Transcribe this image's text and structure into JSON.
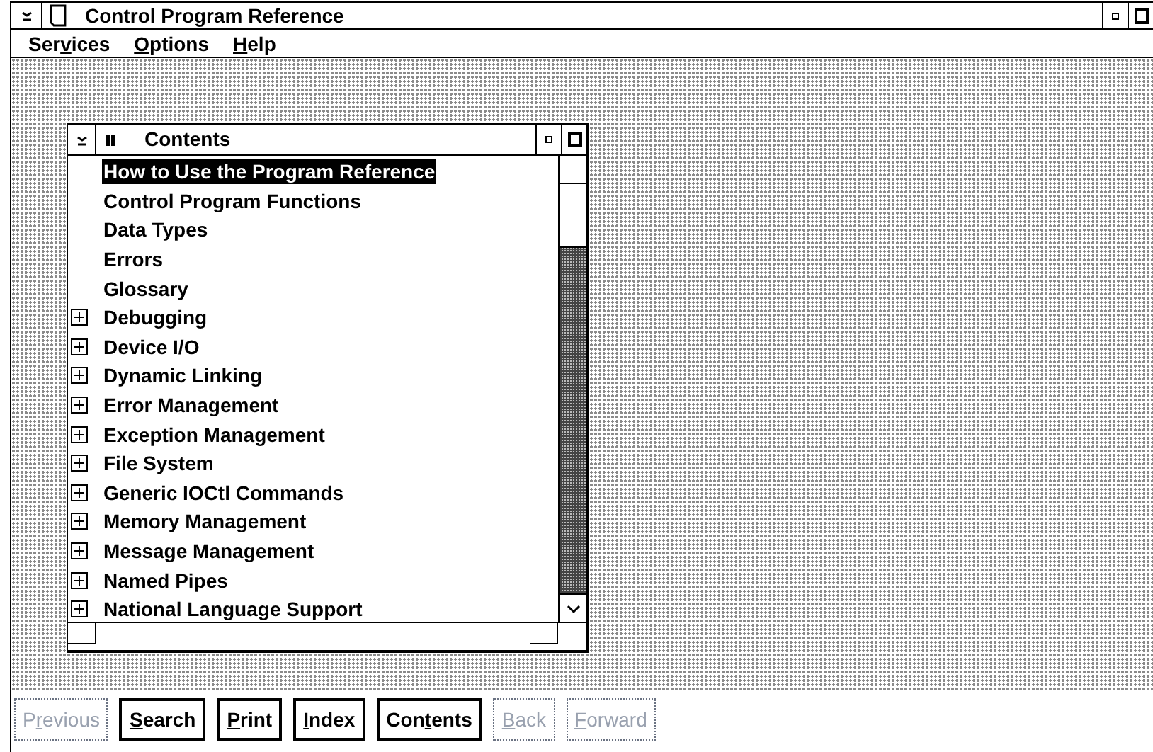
{
  "window": {
    "title": "Control Program Reference"
  },
  "menu": [
    {
      "before": "Ser",
      "key": "v",
      "after": "ices"
    },
    {
      "key": "O",
      "after": "ptions"
    },
    {
      "key": "H",
      "after": "elp"
    }
  ],
  "contents_window": {
    "title": "Contents",
    "items": [
      {
        "label": "How to Use the Program Reference",
        "expandable": false,
        "selected": true
      },
      {
        "label": "Control Program Functions",
        "expandable": false,
        "selected": false
      },
      {
        "label": "Data Types",
        "expandable": false,
        "selected": false
      },
      {
        "label": "Errors",
        "expandable": false,
        "selected": false
      },
      {
        "label": "Glossary",
        "expandable": false,
        "selected": false
      },
      {
        "label": "Debugging",
        "expandable": true,
        "selected": false
      },
      {
        "label": "Device I/O",
        "expandable": true,
        "selected": false
      },
      {
        "label": "Dynamic Linking",
        "expandable": true,
        "selected": false
      },
      {
        "label": "Error Management",
        "expandable": true,
        "selected": false
      },
      {
        "label": "Exception Management",
        "expandable": true,
        "selected": false
      },
      {
        "label": "File System",
        "expandable": true,
        "selected": false
      },
      {
        "label": "Generic IOCtl Commands",
        "expandable": true,
        "selected": false
      },
      {
        "label": "Memory Management",
        "expandable": true,
        "selected": false
      },
      {
        "label": "Message Management",
        "expandable": true,
        "selected": false
      },
      {
        "label": "Named Pipes",
        "expandable": true,
        "selected": false
      },
      {
        "label": "National Language Support",
        "expandable": true,
        "selected": false
      }
    ]
  },
  "buttons": [
    {
      "before": "P",
      "key": "r",
      "after": "evious",
      "disabled": true
    },
    {
      "key": "S",
      "after": "earch",
      "disabled": false
    },
    {
      "key": "P",
      "after": "rint",
      "disabled": false
    },
    {
      "key": "I",
      "after": "ndex",
      "disabled": false
    },
    {
      "before": "Con",
      "key": "t",
      "after": "ents",
      "disabled": false
    },
    {
      "key": "B",
      "after": "ack",
      "disabled": true
    },
    {
      "key": "F",
      "after": "orward",
      "disabled": true
    }
  ]
}
